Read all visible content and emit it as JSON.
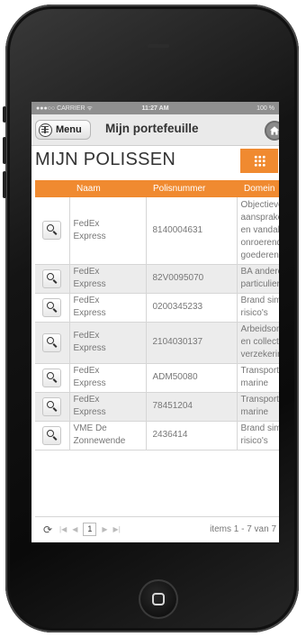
{
  "status_bar": {
    "carrier": "●●●○○ CARRIER ᯤ",
    "time": "11:27 AM",
    "battery": "100 %"
  },
  "nav": {
    "menu_label": "Menu",
    "title": "Mijn portefeuille"
  },
  "page_heading": "MIJN POLISSEN",
  "grid": {
    "columns": [
      "",
      "Naam",
      "Polisnummer",
      "Domein"
    ],
    "rows": [
      {
        "name": [
          "FedEx",
          "Express"
        ],
        "policy": "8140004631",
        "domain": [
          "Objectieve",
          "aansprakelijkheid",
          "en vandalisme",
          "onroerende",
          "goederen"
        ]
      },
      {
        "name": [
          "FedEx",
          "Express"
        ],
        "policy": "82V0095070",
        "domain": [
          "BA andere",
          "particulieren"
        ]
      },
      {
        "name": [
          "FedEx",
          "Express"
        ],
        "policy": "0200345233",
        "domain": [
          "Brand simpele",
          "risico's"
        ]
      },
      {
        "name": [
          "FedEx",
          "Express"
        ],
        "policy": "2104030137",
        "domain": [
          "Arbeidsongevallen",
          "en collectieve",
          "verzekering"
        ]
      },
      {
        "name": [
          "FedEx",
          "Express"
        ],
        "policy": "ADM50080",
        "domain": [
          "Transport",
          "marine"
        ]
      },
      {
        "name": [
          "FedEx",
          "Express"
        ],
        "policy": "78451204",
        "domain": [
          "Transport",
          "marine"
        ]
      },
      {
        "name": [
          "VME De",
          "Zonnewende"
        ],
        "policy": "2436414",
        "domain": [
          "Brand simpele",
          "risico's"
        ]
      }
    ]
  },
  "pager": {
    "current_page": "1",
    "info": "items 1 - 7 van 7"
  },
  "colors": {
    "accent": "#f08a30"
  },
  "icons": [
    "menu-grid-icon",
    "home-icon",
    "grid-dots-icon",
    "search-icon",
    "refresh-icon"
  ]
}
